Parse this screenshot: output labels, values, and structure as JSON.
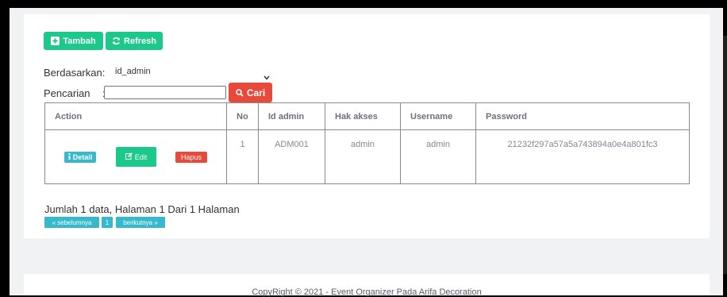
{
  "toolbar": {
    "add_label": "Tambah",
    "refresh_label": "Refresh"
  },
  "filter": {
    "by_label": "Berdasarkan:",
    "selected_field": "id_admin",
    "search_label": "Pencarian",
    "search_separator": ":",
    "search_value": "",
    "search_button": "Cari"
  },
  "table": {
    "headers": [
      "Action",
      "No",
      "Id admin",
      "Hak akses",
      "Username",
      "Password"
    ],
    "rows": [
      {
        "actions": {
          "detail": "Detail",
          "edit": "Edit",
          "delete": "Hapus"
        },
        "no": "1",
        "id_admin": "ADM001",
        "hak_akses": "admin",
        "username": "admin",
        "password": "21232f297a57a5a743894a0e4a801fc3"
      }
    ]
  },
  "pagination": {
    "summary": "Jumlah 1 data, Halaman 1 Dari 1 Halaman",
    "prev": "« sebelumnya",
    "current": "1",
    "next": "berikutnya »"
  },
  "footer": {
    "copyright": "CopyRight © 2021 - Event Organizer Pada Arifa Decoration"
  },
  "colors": {
    "primary_green": "#1cc88a",
    "danger_red": "#e74a3b",
    "info_cyan": "#36b9cc"
  },
  "icons": {
    "add": "plus-square-icon",
    "refresh": "refresh-icon",
    "search": "search-icon",
    "detail": "info-icon",
    "edit": "edit-icon",
    "select": "chevron-down-icon"
  }
}
